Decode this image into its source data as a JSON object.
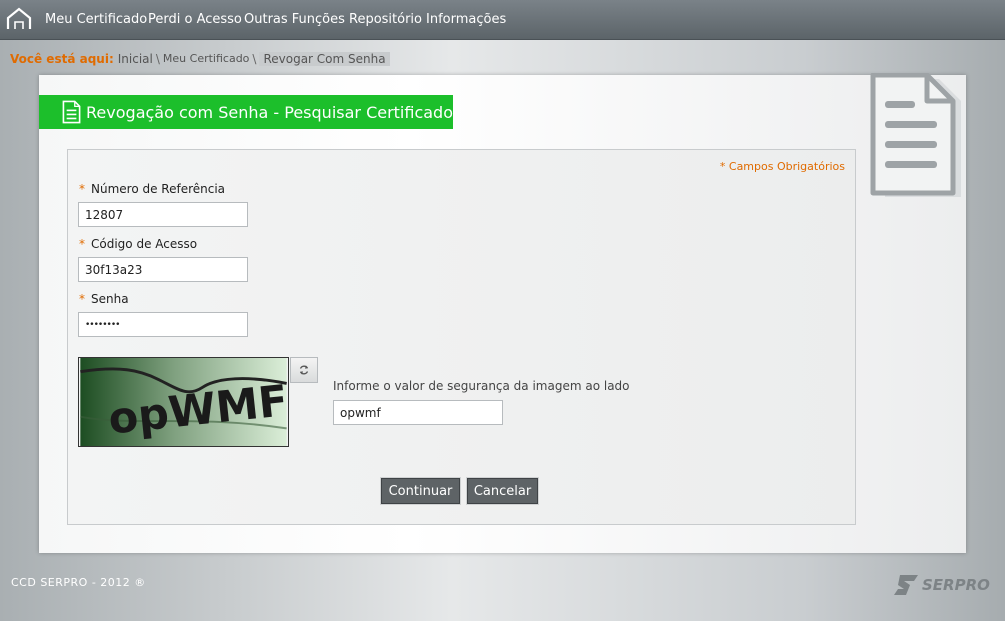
{
  "nav": {
    "items": [
      "Meu Certificado",
      "Perdi o Acesso",
      "Outras Funções",
      "Repositório",
      "Informações"
    ]
  },
  "breadcrumb": {
    "label": "Você está aqui:",
    "items": [
      "Inicial",
      "Meu Certificado"
    ],
    "current": "Revogar Com Senha"
  },
  "page": {
    "title": "Revogação com Senha - Pesquisar Certificado"
  },
  "form": {
    "required_note": "* Campos Obrigatórios",
    "star": "*",
    "reference": {
      "label": "Número de Referência",
      "value": "12807"
    },
    "access_code": {
      "label": "Código de Acesso",
      "value": "30f13a23"
    },
    "password": {
      "label": "Senha",
      "value": "••••••••"
    },
    "captcha": {
      "image_text": "opWMF",
      "label": "Informe o valor de segurança da imagem ao lado",
      "value": "opwmf"
    },
    "continue_label": "Continuar",
    "cancel_label": "Cancelar"
  },
  "footer": {
    "text": "CCD SERPRO - 2012 ®",
    "logo_text": "SERPRO"
  },
  "colors": {
    "accent_orange": "#e06b00",
    "title_green": "#1cbf2b",
    "button_gray": "#5e6366"
  },
  "icons": [
    "home-icon",
    "document-icon",
    "refresh-icon",
    "serpro-logo-icon"
  ]
}
